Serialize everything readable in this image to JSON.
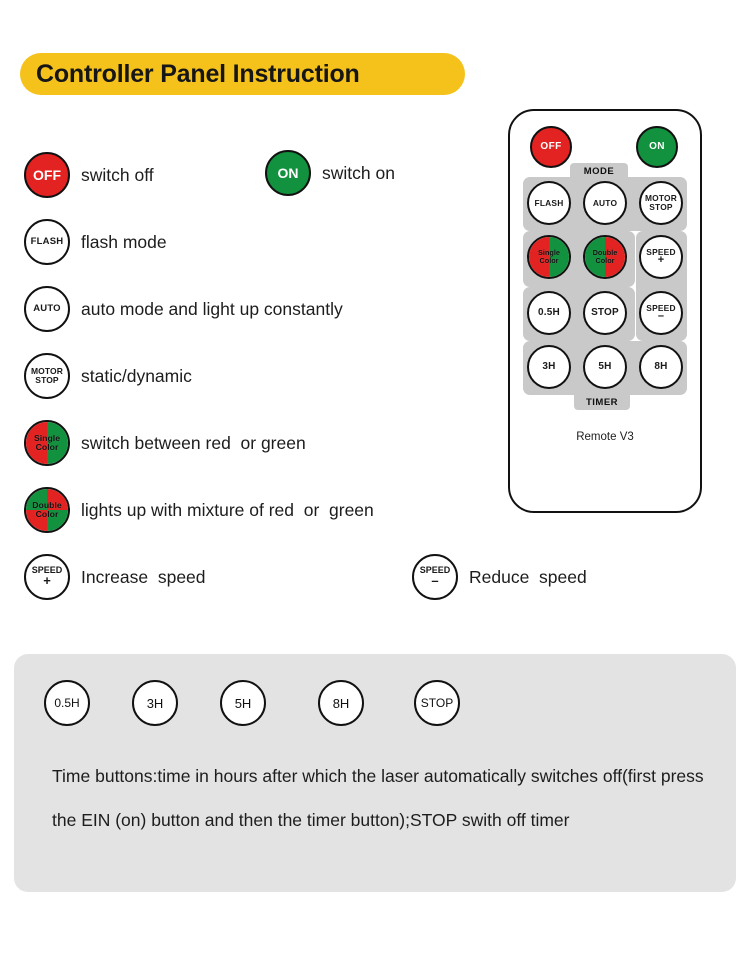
{
  "title": "Controller Panel Instruction",
  "legend": {
    "rows": [
      {
        "items": [
          {
            "button": {
              "kind": "solid-red",
              "label": "OFF"
            },
            "text": "switch off"
          },
          {
            "button": {
              "kind": "solid-green",
              "label": "ON"
            },
            "text": "switch on"
          }
        ]
      },
      {
        "items": [
          {
            "button": {
              "kind": "outline",
              "label": "FLASH"
            },
            "text": "flash mode"
          }
        ]
      },
      {
        "items": [
          {
            "button": {
              "kind": "outline",
              "label": "AUTO"
            },
            "text": "auto mode and light up constantly"
          }
        ]
      },
      {
        "items": [
          {
            "button": {
              "kind": "outline-two",
              "label_line1": "MOTOR",
              "label_line2": "STOP"
            },
            "text": "static/dynamic"
          }
        ]
      },
      {
        "items": [
          {
            "button": {
              "kind": "split",
              "label_line1": "Single",
              "label_line2": "Color"
            },
            "text": "switch between red  or green"
          }
        ]
      },
      {
        "items": [
          {
            "button": {
              "kind": "quad",
              "label_line1": "Double",
              "label_line2": "Color"
            },
            "text": "lights up with mixture of red  or  green"
          }
        ]
      },
      {
        "items": [
          {
            "button": {
              "kind": "speed",
              "label_line1": "SPEED",
              "label_line2": "+"
            },
            "text": "Increase  speed"
          },
          {
            "button": {
              "kind": "speed",
              "label_line1": "SPEED",
              "label_line2": "–"
            },
            "text": "Reduce  speed"
          }
        ]
      }
    ]
  },
  "remote": {
    "name": "Remote V3",
    "group_labels": {
      "mode": "MODE",
      "timer": "TIMER"
    },
    "buttons": {
      "off": "OFF",
      "on": "ON",
      "flash": "FLASH",
      "auto": "AUTO",
      "motor_line1": "MOTOR",
      "motor_line2": "STOP",
      "single_line1": "Single",
      "single_line2": "Color",
      "double_line1": "Double",
      "double_line2": "Color",
      "speed_up_line1": "SPEED",
      "speed_up_line2": "+",
      "speed_down_line1": "SPEED",
      "speed_down_line2": "–",
      "half_hour": "0.5H",
      "stop": "STOP",
      "three_hour": "3H",
      "five_hour": "5H",
      "eight_hour": "8H"
    }
  },
  "bottom": {
    "timer_buttons": [
      "0.5H",
      "3H",
      "5H",
      "8H",
      "STOP"
    ],
    "description": "Time buttons:time in hours after which the laser automatically switches off(first press the EIN (on) button and then the timer button);STOP swith off timer"
  },
  "colors": {
    "banner": "#F5C21B",
    "red": "#E32222",
    "green": "#12913E",
    "panel_gray": "#E3E3E3",
    "remote_gray": "#C9C9C9"
  }
}
